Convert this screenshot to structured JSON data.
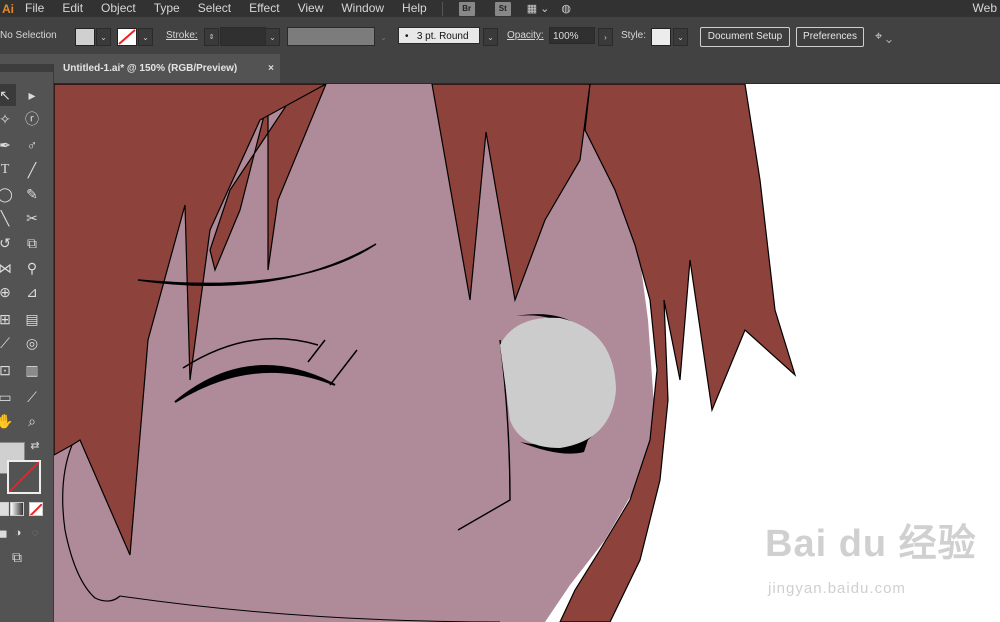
{
  "menubar": {
    "app_logo": "Ai",
    "items": [
      "File",
      "Edit",
      "Object",
      "Type",
      "Select",
      "Effect",
      "View",
      "Window",
      "Help"
    ],
    "bridge_label": "Br",
    "stock_label": "St",
    "workspace_label": "Web"
  },
  "controlbar": {
    "selection_status": "No Selection",
    "stroke_label": "Stroke:",
    "brush_label": "3 pt. Round",
    "opacity_label": "Opacity:",
    "opacity_value": "100%",
    "style_label": "Style:",
    "document_setup_label": "Document Setup",
    "preferences_label": "Preferences",
    "fill_color": "#d0d0d0"
  },
  "document_tab": {
    "title": "Untitled-1.ai* @ 150% (RGB/Preview)",
    "close_glyph": "×"
  },
  "artwork": {
    "hair_color": "#8e423c",
    "skin_color": "#af8a98",
    "eye_white_color": "#cccccc",
    "line_color": "#000000"
  },
  "watermark": {
    "logo_text": "Bai du 经验",
    "url_text": "jingyan.baidu.com"
  }
}
